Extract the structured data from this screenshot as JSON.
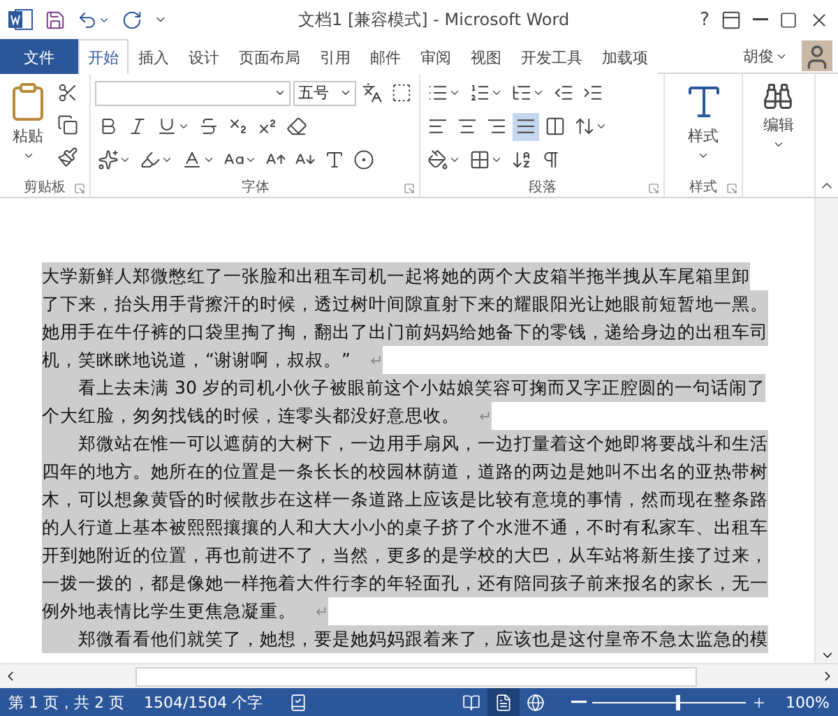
{
  "window": {
    "title": "文档1 [兼容模式] - Microsoft Word",
    "help": "?"
  },
  "tabs": [
    {
      "label": "文件",
      "kind": "file",
      "selected": false
    },
    {
      "label": "开始",
      "kind": "tab",
      "selected": true
    },
    {
      "label": "插入",
      "kind": "tab",
      "selected": false
    },
    {
      "label": "设计",
      "kind": "tab",
      "selected": false
    },
    {
      "label": "页面布局",
      "kind": "tab",
      "selected": false
    },
    {
      "label": "引用",
      "kind": "tab",
      "selected": false
    },
    {
      "label": "邮件",
      "kind": "tab",
      "selected": false
    },
    {
      "label": "审阅",
      "kind": "tab",
      "selected": false
    },
    {
      "label": "视图",
      "kind": "tab",
      "selected": false
    },
    {
      "label": "开发工具",
      "kind": "tab",
      "selected": false
    },
    {
      "label": "加载项",
      "kind": "tab",
      "selected": false
    }
  ],
  "user": {
    "name": "胡俊"
  },
  "ribbon": {
    "clipboard": {
      "label": "剪贴板",
      "paste": "粘贴"
    },
    "font": {
      "label": "字体",
      "size": "五号"
    },
    "paragraph": {
      "label": "段落",
      "alignments": [
        {
          "selected": false
        },
        {
          "selected": false
        },
        {
          "selected": false
        },
        {
          "selected": true
        },
        {
          "selected": false
        }
      ]
    },
    "styles": {
      "label": "样式",
      "button": "样式"
    },
    "editing": {
      "button": "编辑"
    }
  },
  "document": {
    "paragraphs": [
      {
        "indent": false,
        "selected": true,
        "mark": "↵",
        "lines": [
          "大学新鲜人郑微憋红了一张脸和出租车司机一起将她的两个大皮箱半拖半拽从车尾箱里卸",
          "了下来，抬头用手背擦汗的时候，透过树叶间隙直射下来的耀眼阳光让她眼前短暂地一黑。",
          "她用手在牛仔裤的口袋里掏了掏，翻出了出门前妈妈给她备下的零钱，递给身边的出租车司",
          "机，笑眯眯地说道，“谢谢啊，叔叔。”"
        ]
      },
      {
        "indent": true,
        "selected": true,
        "mark": "↵",
        "lines": [
          "看上去未满 30 岁的司机小伙子被眼前这个小姑娘笑容可掬而又字正腔圆的一句话闹了",
          "个大红脸，匆匆找钱的时候，连零头都没好意思收。"
        ]
      },
      {
        "indent": true,
        "selected": true,
        "mark": "↵",
        "lines": [
          "郑微站在惟一可以遮荫的大树下，一边用手扇风，一边打量着这个她即将要战斗和生活",
          "四年的地方。她所在的位置是一条长长的校园林荫道，道路的两边是她叫不出名的亚热带树",
          "木，可以想象黄昏的时候散步在这样一条道路上应该是比较有意境的事情，然而现在整条路",
          "的人行道上基本被熙熙攘攘的人和大大小小的桌子挤了个水泄不通，不时有私家车、出租车",
          "开到她附近的位置，再也前进不了，当然，更多的是学校的大巴，从车站将新生接了过来，",
          "一拨一拨的，都是像她一样拖着大件行李的年轻面孔，还有陪同孩子前来报名的家长，无一",
          "例外地表情比学生更焦急凝重。"
        ]
      },
      {
        "indent": true,
        "selected": true,
        "lines": [
          "郑微看看他们就笑了，她想，要是她妈妈跟着来了，应该也是这付皇帝不急太监急的模"
        ]
      }
    ]
  },
  "status": {
    "page": "第 1 页，共 2 页",
    "words": "1504/1504 个字",
    "views": [
      {
        "kind": "read",
        "selected": false
      },
      {
        "kind": "print",
        "selected": true
      },
      {
        "kind": "web",
        "selected": false
      }
    ],
    "zoom": {
      "level": 0.55,
      "reading": "100%"
    }
  }
}
